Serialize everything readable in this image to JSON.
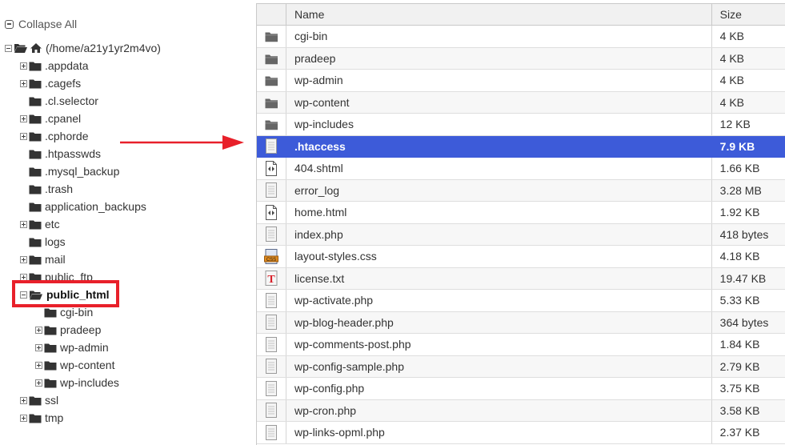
{
  "tree": {
    "collapse_all_label": "Collapse All",
    "root_label": "(/home/a21y1yr2m4vo)",
    "nodes": [
      {
        "label": ".appdata",
        "toggle": "plus"
      },
      {
        "label": ".cagefs",
        "toggle": "plus"
      },
      {
        "label": ".cl.selector",
        "toggle": "none"
      },
      {
        "label": ".cpanel",
        "toggle": "plus"
      },
      {
        "label": ".cphorde",
        "toggle": "plus"
      },
      {
        "label": ".htpasswds",
        "toggle": "none"
      },
      {
        "label": ".mysql_backup",
        "toggle": "none"
      },
      {
        "label": ".trash",
        "toggle": "none"
      },
      {
        "label": "application_backups",
        "toggle": "none"
      },
      {
        "label": "etc",
        "toggle": "plus"
      },
      {
        "label": "logs",
        "toggle": "none"
      },
      {
        "label": "mail",
        "toggle": "plus"
      },
      {
        "label": "public_ftp",
        "toggle": "plus"
      },
      {
        "label": "public_html",
        "toggle": "minus",
        "open": true,
        "bold": true
      },
      {
        "label": "cgi-bin",
        "toggle": "none",
        "child": true
      },
      {
        "label": "pradeep",
        "toggle": "plus",
        "child": true
      },
      {
        "label": "wp-admin",
        "toggle": "plus",
        "child": true
      },
      {
        "label": "wp-content",
        "toggle": "plus",
        "child": true
      },
      {
        "label": "wp-includes",
        "toggle": "plus",
        "child": true
      },
      {
        "label": "ssl",
        "toggle": "plus"
      },
      {
        "label": "tmp",
        "toggle": "plus"
      }
    ]
  },
  "table": {
    "headers": {
      "name": "Name",
      "size": "Size"
    },
    "rows": [
      {
        "icon": "folder-icon",
        "name": "cgi-bin",
        "size": "4 KB"
      },
      {
        "icon": "folder-icon",
        "name": "pradeep",
        "size": "4 KB"
      },
      {
        "icon": "folder-icon",
        "name": "wp-admin",
        "size": "4 KB"
      },
      {
        "icon": "folder-icon",
        "name": "wp-content",
        "size": "4 KB"
      },
      {
        "icon": "folder-icon",
        "name": "wp-includes",
        "size": "12 KB"
      },
      {
        "icon": "file-icon",
        "name": ".htaccess",
        "size": "7.9 KB",
        "selected": true
      },
      {
        "icon": "html-file-icon",
        "name": "404.shtml",
        "size": "1.66 KB"
      },
      {
        "icon": "file-icon",
        "name": "error_log",
        "size": "3.28 MB"
      },
      {
        "icon": "html-file-icon",
        "name": "home.html",
        "size": "1.92 KB"
      },
      {
        "icon": "file-icon",
        "name": "index.php",
        "size": "418 bytes"
      },
      {
        "icon": "css-file-icon",
        "name": "layout-styles.css",
        "size": "4.18 KB"
      },
      {
        "icon": "text-file-icon",
        "name": "license.txt",
        "size": "19.47 KB"
      },
      {
        "icon": "file-icon",
        "name": "wp-activate.php",
        "size": "5.33 KB"
      },
      {
        "icon": "file-icon",
        "name": "wp-blog-header.php",
        "size": "364 bytes"
      },
      {
        "icon": "file-icon",
        "name": "wp-comments-post.php",
        "size": "1.84 KB"
      },
      {
        "icon": "file-icon",
        "name": "wp-config-sample.php",
        "size": "2.79 KB"
      },
      {
        "icon": "file-icon",
        "name": "wp-config.php",
        "size": "3.75 KB"
      },
      {
        "icon": "file-icon",
        "name": "wp-cron.php",
        "size": "3.58 KB"
      },
      {
        "icon": "file-icon",
        "name": "wp-links-opml.php",
        "size": "2.37 KB"
      }
    ]
  },
  "colors": {
    "selection": "#3d5bd9",
    "highlight_box": "#e8202a",
    "arrow": "#e8202a"
  }
}
